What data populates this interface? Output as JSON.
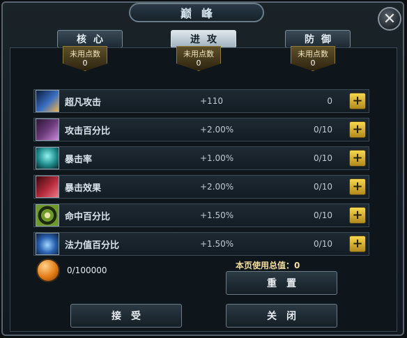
{
  "window": {
    "title": "巅峰",
    "close_icon": "close-icon"
  },
  "tabs": [
    {
      "label": "核心",
      "active": false
    },
    {
      "label": "进攻",
      "active": true
    },
    {
      "label": "防御",
      "active": false
    }
  ],
  "unused_points": [
    {
      "label": "未用点数",
      "value": "0"
    },
    {
      "label": "未用点数",
      "value": "0"
    },
    {
      "label": "未用点数",
      "value": "0"
    }
  ],
  "stats": [
    {
      "name": "超凡攻击",
      "bonus": "+110",
      "count": "0",
      "icon": "sword-icon",
      "icon_color": "#3a6fc2"
    },
    {
      "name": "攻击百分比",
      "bonus": "+2.00%",
      "count": "0/10",
      "icon": "claw-icon",
      "icon_color": "#6b3a7a"
    },
    {
      "name": "暴击率",
      "bonus": "+1.00%",
      "count": "0/10",
      "icon": "spirit-icon",
      "icon_color": "#1f8a8a"
    },
    {
      "name": "暴击效果",
      "bonus": "+2.00%",
      "count": "0/10",
      "icon": "slash-icon",
      "icon_color": "#b52b3b"
    },
    {
      "name": "命中百分比",
      "bonus": "+1.50%",
      "count": "0/10",
      "icon": "target-icon",
      "icon_color": "#6f9a2b"
    },
    {
      "name": "法力值百分比",
      "bonus": "+1.50%",
      "count": "0/10",
      "icon": "heart-icon",
      "icon_color": "#2a62b0"
    }
  ],
  "plus_label": "+",
  "currency": {
    "value": "0/100000",
    "icon": "orb-icon"
  },
  "page_total": "本页使用总值：0",
  "buttons": {
    "reset": "重置",
    "accept": "接受",
    "close": "关闭"
  }
}
